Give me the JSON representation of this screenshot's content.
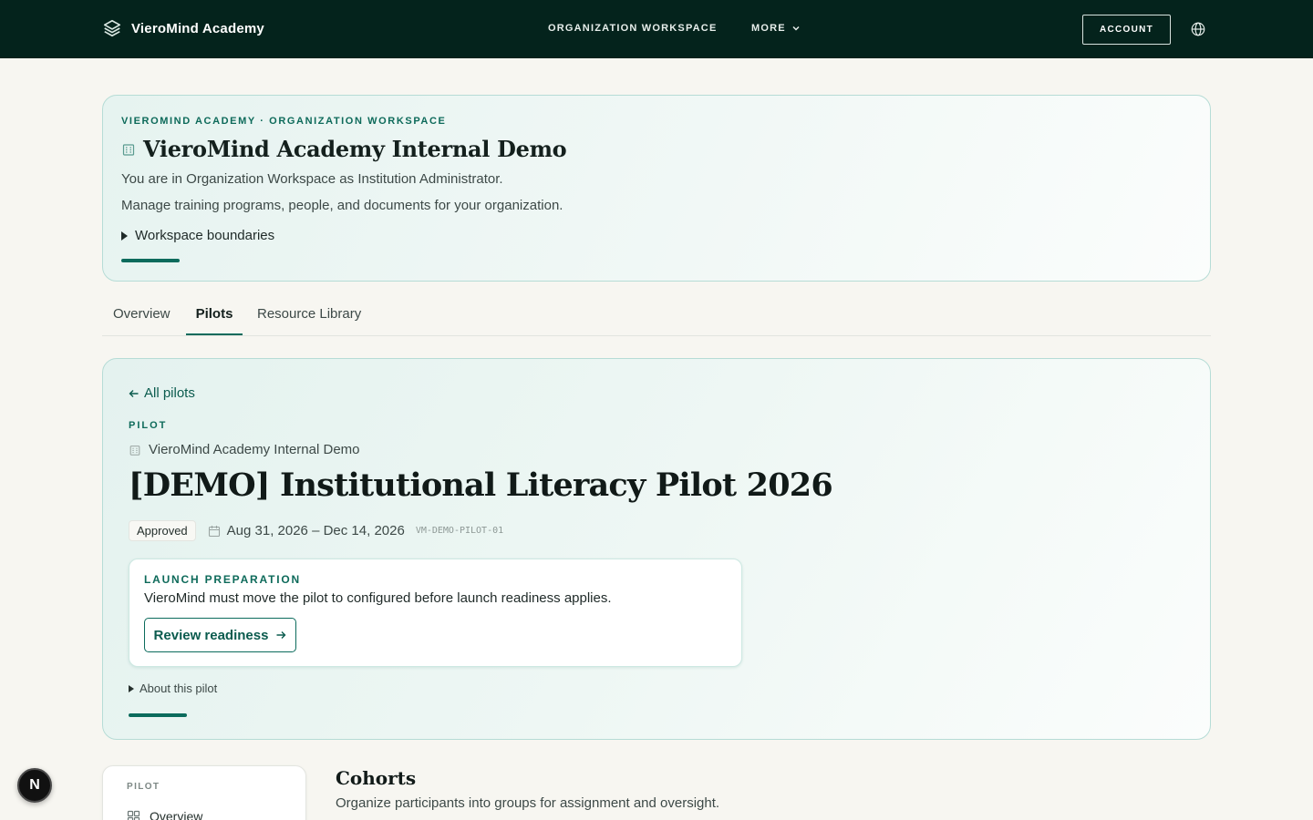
{
  "topbar": {
    "brand_name": "VieroMind Academy",
    "brand_icon": "layers-icon",
    "nav": {
      "workspace_label": "ORGANIZATION WORKSPACE",
      "more_label": "MORE"
    },
    "account_label": "ACCOUNT",
    "language_icon": "globe-icon"
  },
  "org_header": {
    "eyebrow": "VIEROMIND ACADEMY · ORGANIZATION WORKSPACE",
    "title_icon": "building-icon",
    "title": "VieroMind Academy Internal Demo",
    "subtitle_role": "You are in Organization Workspace as Institution Administrator.",
    "subtitle_desc": "Manage training programs, people, and documents for your organization.",
    "details_label": "Workspace boundaries"
  },
  "tabs": {
    "overview": "Overview",
    "pilots": "Pilots",
    "library": "Resource Library",
    "active": "Pilots"
  },
  "pilot": {
    "back_label": "All pilots",
    "eyebrow": "PILOT",
    "org_name": "VieroMind Academy Internal Demo",
    "title": "[DEMO] Institutional Literacy Pilot 2026",
    "status": "Approved",
    "date_range": "Aug 31, 2026 – Dec 14, 2026",
    "code": "VM-DEMO-PILOT-01",
    "launch": {
      "eyebrow": "LAUNCH PREPARATION",
      "text": "VieroMind must move the pilot to configured before launch readiness applies.",
      "button_label": "Review readiness"
    },
    "about_label": "About this pilot"
  },
  "side_nav": {
    "eyebrow": "PILOT",
    "items": [
      {
        "label": "Overview",
        "icon": "grid-icon"
      }
    ]
  },
  "cohorts": {
    "title": "Cohorts",
    "subtitle": "Organize participants into groups for assignment and oversight."
  },
  "dev_badge": {
    "label": "N"
  },
  "colors": {
    "topbar_bg": "#04231c",
    "accent": "#0b6b5c",
    "card_border": "#b6dcd6",
    "page_bg": "#f7f6f1"
  }
}
